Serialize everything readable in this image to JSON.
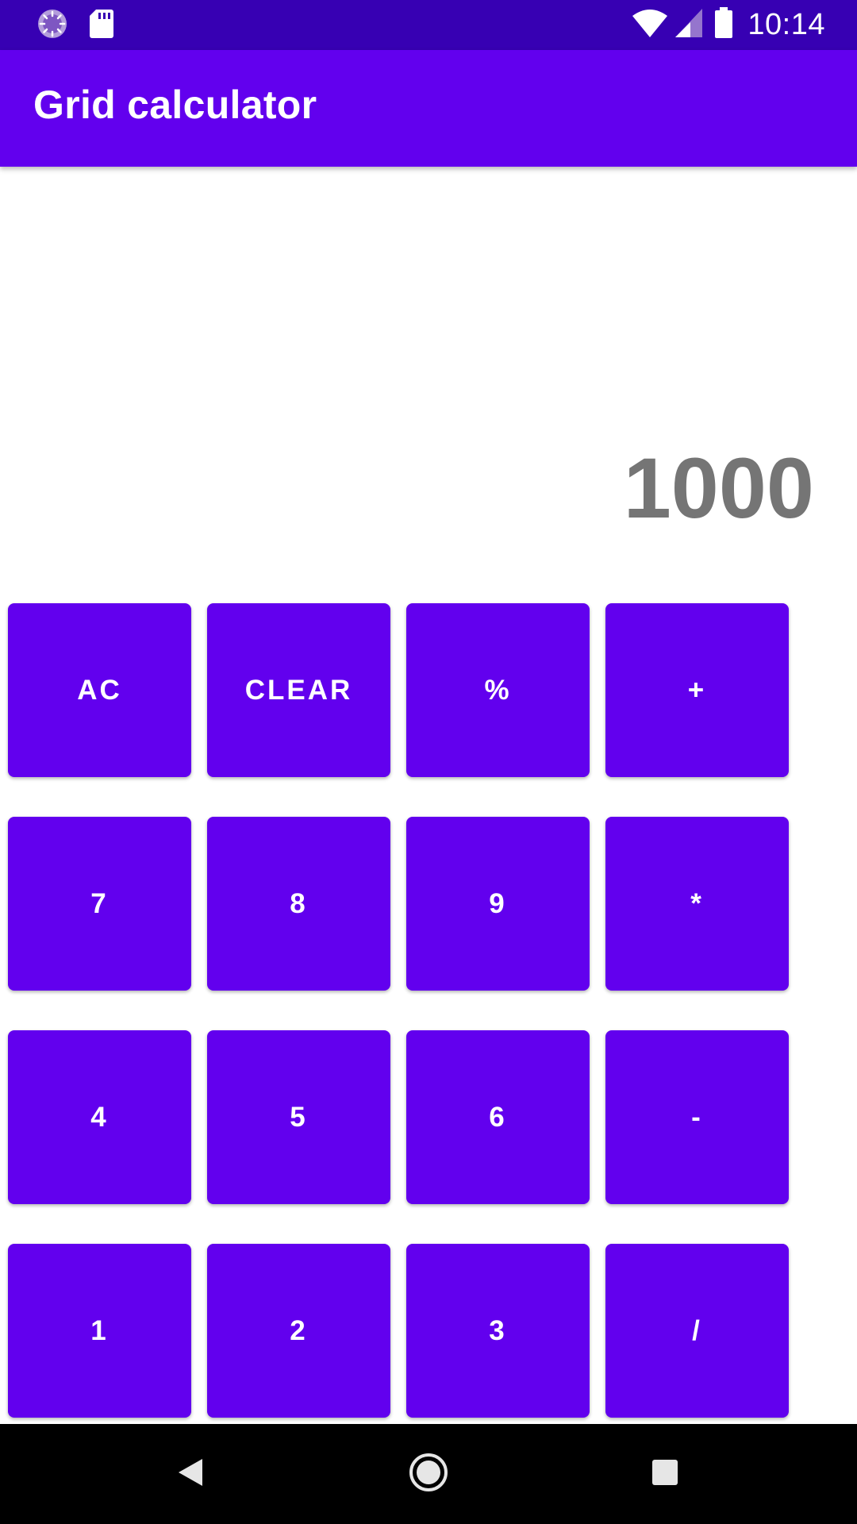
{
  "status_bar": {
    "time": "10:14",
    "icons": [
      "sync-icon",
      "sd-card-icon",
      "wifi-icon",
      "cell-signal-icon",
      "battery-icon"
    ]
  },
  "app_bar": {
    "title": "Grid calculator"
  },
  "display": {
    "value": "1000"
  },
  "keypad": {
    "rows": [
      [
        "AC",
        "CLEAR",
        "%",
        "+"
      ],
      [
        "7",
        "8",
        "9",
        "*"
      ],
      [
        "4",
        "5",
        "6",
        "-"
      ],
      [
        "1",
        "2",
        "3",
        "/"
      ]
    ]
  },
  "colors": {
    "status_bar": "#3700b3",
    "primary": "#6200ee",
    "display_text": "#757575",
    "nav_bar": "#000000"
  },
  "nav_bar": {
    "icons": [
      "back-icon",
      "home-icon",
      "recents-icon"
    ]
  }
}
